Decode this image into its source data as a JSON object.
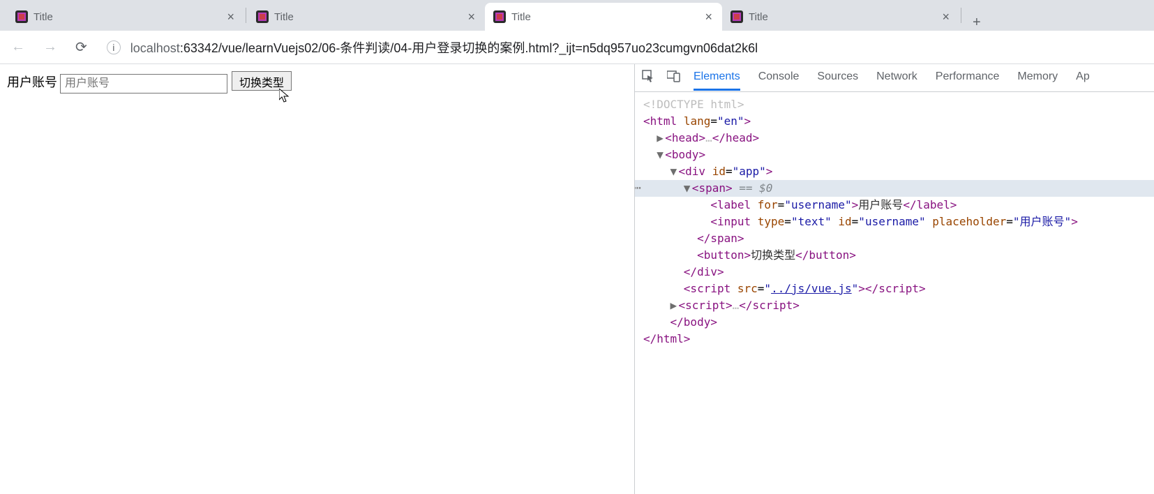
{
  "tabs": [
    {
      "title": "Title",
      "active": false
    },
    {
      "title": "Title",
      "active": false
    },
    {
      "title": "Title",
      "active": true
    },
    {
      "title": "Title",
      "active": false
    }
  ],
  "address_bar": {
    "host": "localhost",
    "port_path": ":63342/vue/learnVuejs02/06-条件判读/04-用户登录切换的案例.html?_ijt=n5dq957uo23cumgvn06dat2k6l"
  },
  "page": {
    "label": "用户账号",
    "placeholder": "用户账号",
    "button_text": "切换类型"
  },
  "devtools": {
    "tabs": [
      "Elements",
      "Console",
      "Sources",
      "Network",
      "Performance",
      "Memory",
      "Ap"
    ],
    "active_tab": "Elements",
    "dom": {
      "doctype": "<!DOCTYPE html>",
      "html_open": "html",
      "html_lang": "en",
      "head": "head",
      "body": "body",
      "div_id": "app",
      "span": "span",
      "selected_suffix": " == $0",
      "label_for": "username",
      "label_text": "用户账号",
      "input_type": "text",
      "input_id": "username",
      "input_placeholder": "用户账号",
      "button_text": "切换类型",
      "script_src": "../js/vue.js"
    }
  }
}
